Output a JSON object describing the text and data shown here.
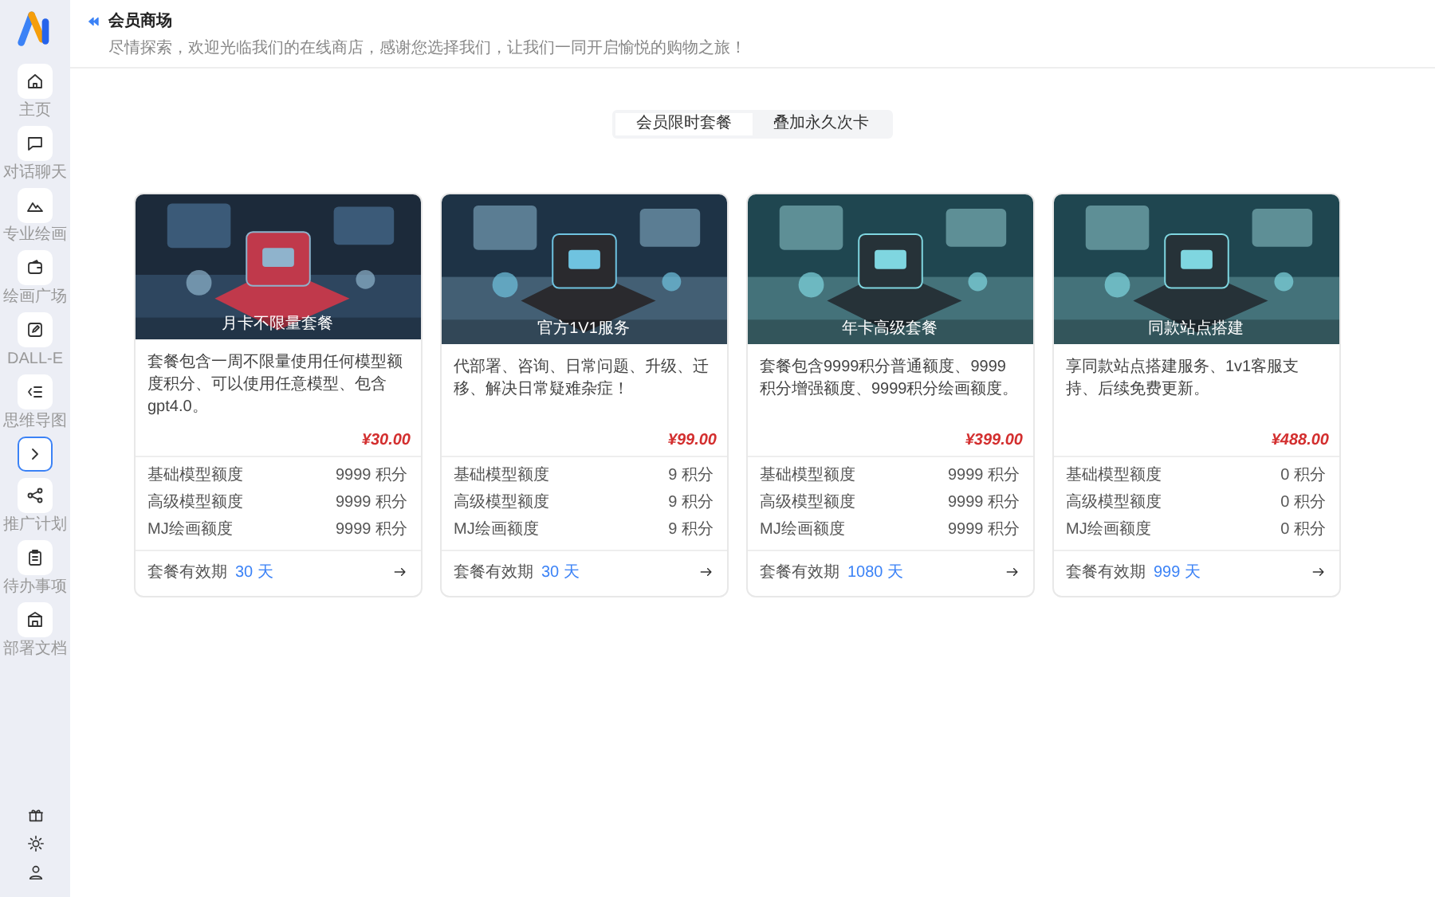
{
  "sidebar": {
    "items": [
      {
        "label": "主页",
        "selected": false
      },
      {
        "label": "对话聊天",
        "selected": false
      },
      {
        "label": "专业绘画",
        "selected": false
      },
      {
        "label": "绘画广场",
        "selected": false
      },
      {
        "label": "DALL-E",
        "selected": false
      },
      {
        "label": "思维导图",
        "selected": false
      },
      {
        "selected": true
      },
      {
        "label": "推广计划",
        "selected": false
      },
      {
        "label": "待办事项",
        "selected": false
      },
      {
        "label": "部署文档",
        "selected": false
      }
    ]
  },
  "header": {
    "title": "会员商场",
    "subtitle": "尽情探索，欢迎光临我们的在线商店，感谢您选择我们，让我们一同开启愉悦的购物之旅！"
  },
  "tabs": [
    {
      "label": "会员限时套餐",
      "selected": true
    },
    {
      "label": "叠加永久次卡",
      "selected": false
    }
  ],
  "cards": [
    {
      "title": "月卡不限量套餐",
      "description": "套餐包含一周不限量使用任何模型额度积分、可以使用任意模型、包含gpt4.0。",
      "price": "¥30.00",
      "quotas": [
        {
          "label": "基础模型额度",
          "value": "9999 积分"
        },
        {
          "label": "高级模型额度",
          "value": "9999 积分"
        },
        {
          "label": "MJ绘画额度",
          "value": "9999 积分"
        }
      ],
      "validity_label": "套餐有效期",
      "validity": "30 天"
    },
    {
      "title": "官方1V1服务",
      "description": "代部署、咨询、日常问题、升级、迁移、解决日常疑难杂症！",
      "price": "¥99.00",
      "quotas": [
        {
          "label": "基础模型额度",
          "value": "9 积分"
        },
        {
          "label": "高级模型额度",
          "value": "9 积分"
        },
        {
          "label": "MJ绘画额度",
          "value": "9 积分"
        }
      ],
      "validity_label": "套餐有效期",
      "validity": "30 天"
    },
    {
      "title": "年卡高级套餐",
      "description": "套餐包含9999积分普通额度、9999积分增强额度、9999积分绘画额度。",
      "price": "¥399.00",
      "quotas": [
        {
          "label": "基础模型额度",
          "value": "9999 积分"
        },
        {
          "label": "高级模型额度",
          "value": "9999 积分"
        },
        {
          "label": "MJ绘画额度",
          "value": "9999 积分"
        }
      ],
      "validity_label": "套餐有效期",
      "validity": "1080 天"
    },
    {
      "title": "同款站点搭建",
      "description": "享同款站点搭建服务、1v1客服支持、后续免费更新。",
      "price": "¥488.00",
      "quotas": [
        {
          "label": "基础模型额度",
          "value": "0 积分"
        },
        {
          "label": "高级模型额度",
          "value": "0 积分"
        },
        {
          "label": "MJ绘画额度",
          "value": "0 积分"
        }
      ],
      "validity_label": "套餐有效期",
      "validity": "999 天"
    }
  ]
}
